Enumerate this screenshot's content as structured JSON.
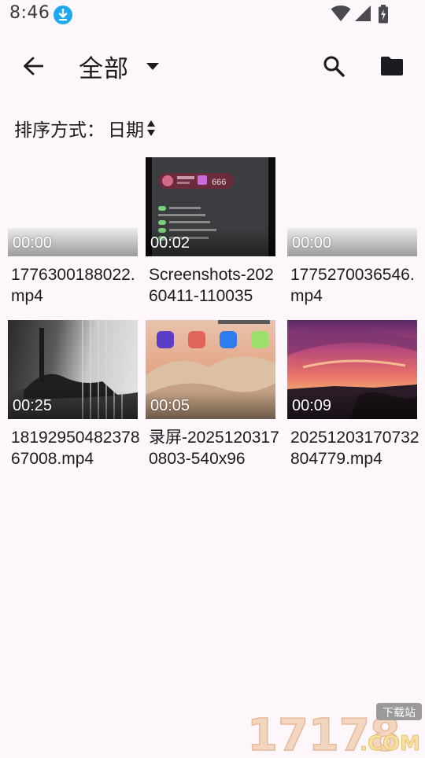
{
  "status_bar": {
    "time": "8:46"
  },
  "app_bar": {
    "title": "全部"
  },
  "sort": {
    "label": "排序方式：",
    "value": "日期"
  },
  "videos": [
    {
      "duration": "00:00",
      "filename": "1776300188022.mp4"
    },
    {
      "duration": "00:02",
      "filename": "Screenshots-20260411-110035"
    },
    {
      "duration": "00:00",
      "filename": "1775270036546.mp4"
    },
    {
      "duration": "00:25",
      "filename": "1819295048237867008.mp4"
    },
    {
      "duration": "00:05",
      "filename": "录屏-20251203170803-540x96"
    },
    {
      "duration": "00:09",
      "filename": "20251203170732804779.mp4"
    }
  ],
  "thumb_texts": {
    "likes": "666"
  },
  "watermark": {
    "number": "17178",
    "tag": "下载站",
    "domain": ".COM"
  },
  "colors": {
    "background": "#fdf6fb",
    "download_badge": "#1ea8f0",
    "text": "#1c1b1f"
  }
}
